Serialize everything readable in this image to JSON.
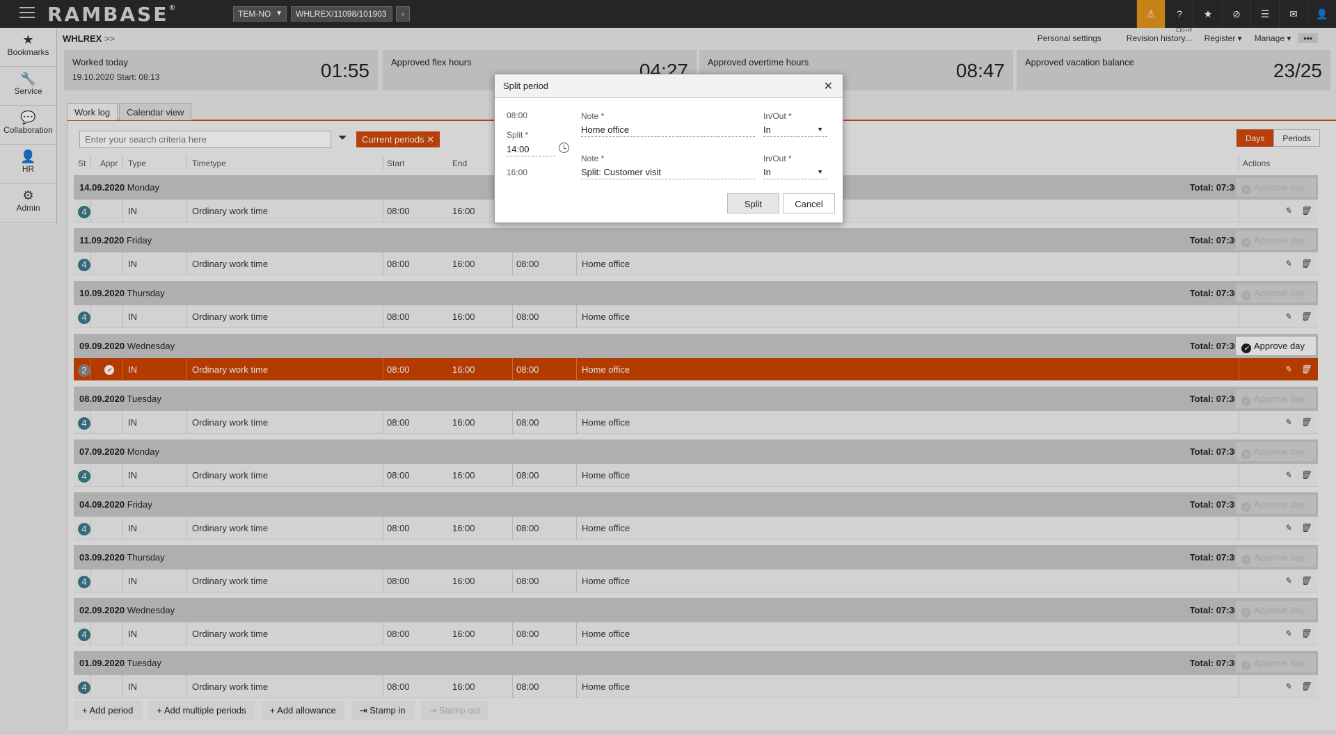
{
  "topbar": {
    "logo": "RAMBASE",
    "logo_mark": "®",
    "company": "TEM-NO",
    "path": "WHLREX/11098/101903",
    "back": "‹"
  },
  "nav": [
    {
      "icon": "★",
      "label": "Bookmarks"
    },
    {
      "icon": "🔧",
      "label": "Service"
    },
    {
      "icon": "💬",
      "label": "Collaboration"
    },
    {
      "icon": "👤",
      "label": "HR"
    },
    {
      "icon": "⚙",
      "label": "Admin"
    }
  ],
  "header": {
    "crumb": "WHLREX",
    "crumb_sep": ">>",
    "personal_settings": "Personal settings",
    "revision_history": "Revision history...",
    "revision_shortcut": "Ctrl+H",
    "register": "Register ▾",
    "manage": "Manage ▾",
    "more": "•••"
  },
  "kpis": {
    "worked_label": "Worked today",
    "worked_sub": "19.10.2020 Start: 08:13",
    "worked_value": "01:55",
    "flex_label": "Approved flex hours",
    "flex_value": "04:27",
    "overtime_label": "Approved overtime hours",
    "overtime_value": "08:47",
    "vacation_label": "Approved vacation balance",
    "vacation_value": "23/25"
  },
  "tabs": {
    "worklog": "Work log",
    "calendar": "Calendar view"
  },
  "toolbar": {
    "search_placeholder": "Enter your search criteria here",
    "chip": "Current periods ✕",
    "days": "Days",
    "periods": "Periods"
  },
  "columns": {
    "st": "St",
    "appr": "Appr",
    "type": "Type",
    "timetype": "Timetype",
    "start": "Start",
    "end": "End",
    "actions": "Actions"
  },
  "approve_label": "Approve day",
  "total_prefix": "Total:",
  "days": [
    {
      "date": "14.09.2020",
      "weekday": "Monday",
      "total": "07:30",
      "status": "4",
      "type": "IN",
      "timetype": "Ordinary work time",
      "start": "08:00",
      "end": "16:00",
      "hours": "08:00",
      "note": "Home office"
    },
    {
      "date": "11.09.2020",
      "weekday": "Friday",
      "total": "07:30",
      "status": "4",
      "type": "IN",
      "timetype": "Ordinary work time",
      "start": "08:00",
      "end": "16:00",
      "hours": "08:00",
      "note": "Home office"
    },
    {
      "date": "10.09.2020",
      "weekday": "Thursday",
      "total": "07:30",
      "status": "4",
      "type": "IN",
      "timetype": "Ordinary work time",
      "start": "08:00",
      "end": "16:00",
      "hours": "08:00",
      "note": "Home office"
    },
    {
      "date": "09.09.2020",
      "weekday": "Wednesday",
      "total": "07:30",
      "status": "2",
      "type": "IN",
      "timetype": "Ordinary work time",
      "start": "08:00",
      "end": "16:00",
      "hours": "08:00",
      "note": "Home office"
    },
    {
      "date": "08.09.2020",
      "weekday": "Tuesday",
      "total": "07:30",
      "status": "4",
      "type": "IN",
      "timetype": "Ordinary work time",
      "start": "08:00",
      "end": "16:00",
      "hours": "08:00",
      "note": "Home office"
    },
    {
      "date": "07.09.2020",
      "weekday": "Monday",
      "total": "07:30",
      "status": "4",
      "type": "IN",
      "timetype": "Ordinary work time",
      "start": "08:00",
      "end": "16:00",
      "hours": "08:00",
      "note": "Home office"
    },
    {
      "date": "04.09.2020",
      "weekday": "Friday",
      "total": "07:30",
      "status": "4",
      "type": "IN",
      "timetype": "Ordinary work time",
      "start": "08:00",
      "end": "16:00",
      "hours": "08:00",
      "note": "Home office"
    },
    {
      "date": "03.09.2020",
      "weekday": "Thursday",
      "total": "07:30",
      "status": "4",
      "type": "IN",
      "timetype": "Ordinary work time",
      "start": "08:00",
      "end": "16:00",
      "hours": "08:00",
      "note": "Home office"
    },
    {
      "date": "02.09.2020",
      "weekday": "Wednesday",
      "total": "07:30",
      "status": "4",
      "type": "IN",
      "timetype": "Ordinary work time",
      "start": "08:00",
      "end": "16:00",
      "hours": "08:00",
      "note": "Home office"
    },
    {
      "date": "01.09.2020",
      "weekday": "Tuesday",
      "total": "07:30",
      "status": "4",
      "type": "IN",
      "timetype": "Ordinary work time",
      "start": "08:00",
      "end": "16:00",
      "hours": "08:00",
      "note": "Home office"
    }
  ],
  "bottom": {
    "add_period": "+ Add period",
    "add_multiple": "+ Add multiple periods",
    "add_allowance": "+ Add allowance",
    "stamp_in": "⇥ Stamp in",
    "stamp_out": "⇥ Stamp out"
  },
  "modal": {
    "title": "Split period",
    "close": "✕",
    "start_time": "08:00",
    "split_label": "Split *",
    "split_value": "14:00",
    "end_time": "16:00",
    "note_label": "Note *",
    "note1": "Home office",
    "note2": "Split: Customer visit",
    "inout_label": "In/Out *",
    "inout1": "In",
    "inout2": "In",
    "split_btn": "Split",
    "cancel_btn": "Cancel"
  }
}
